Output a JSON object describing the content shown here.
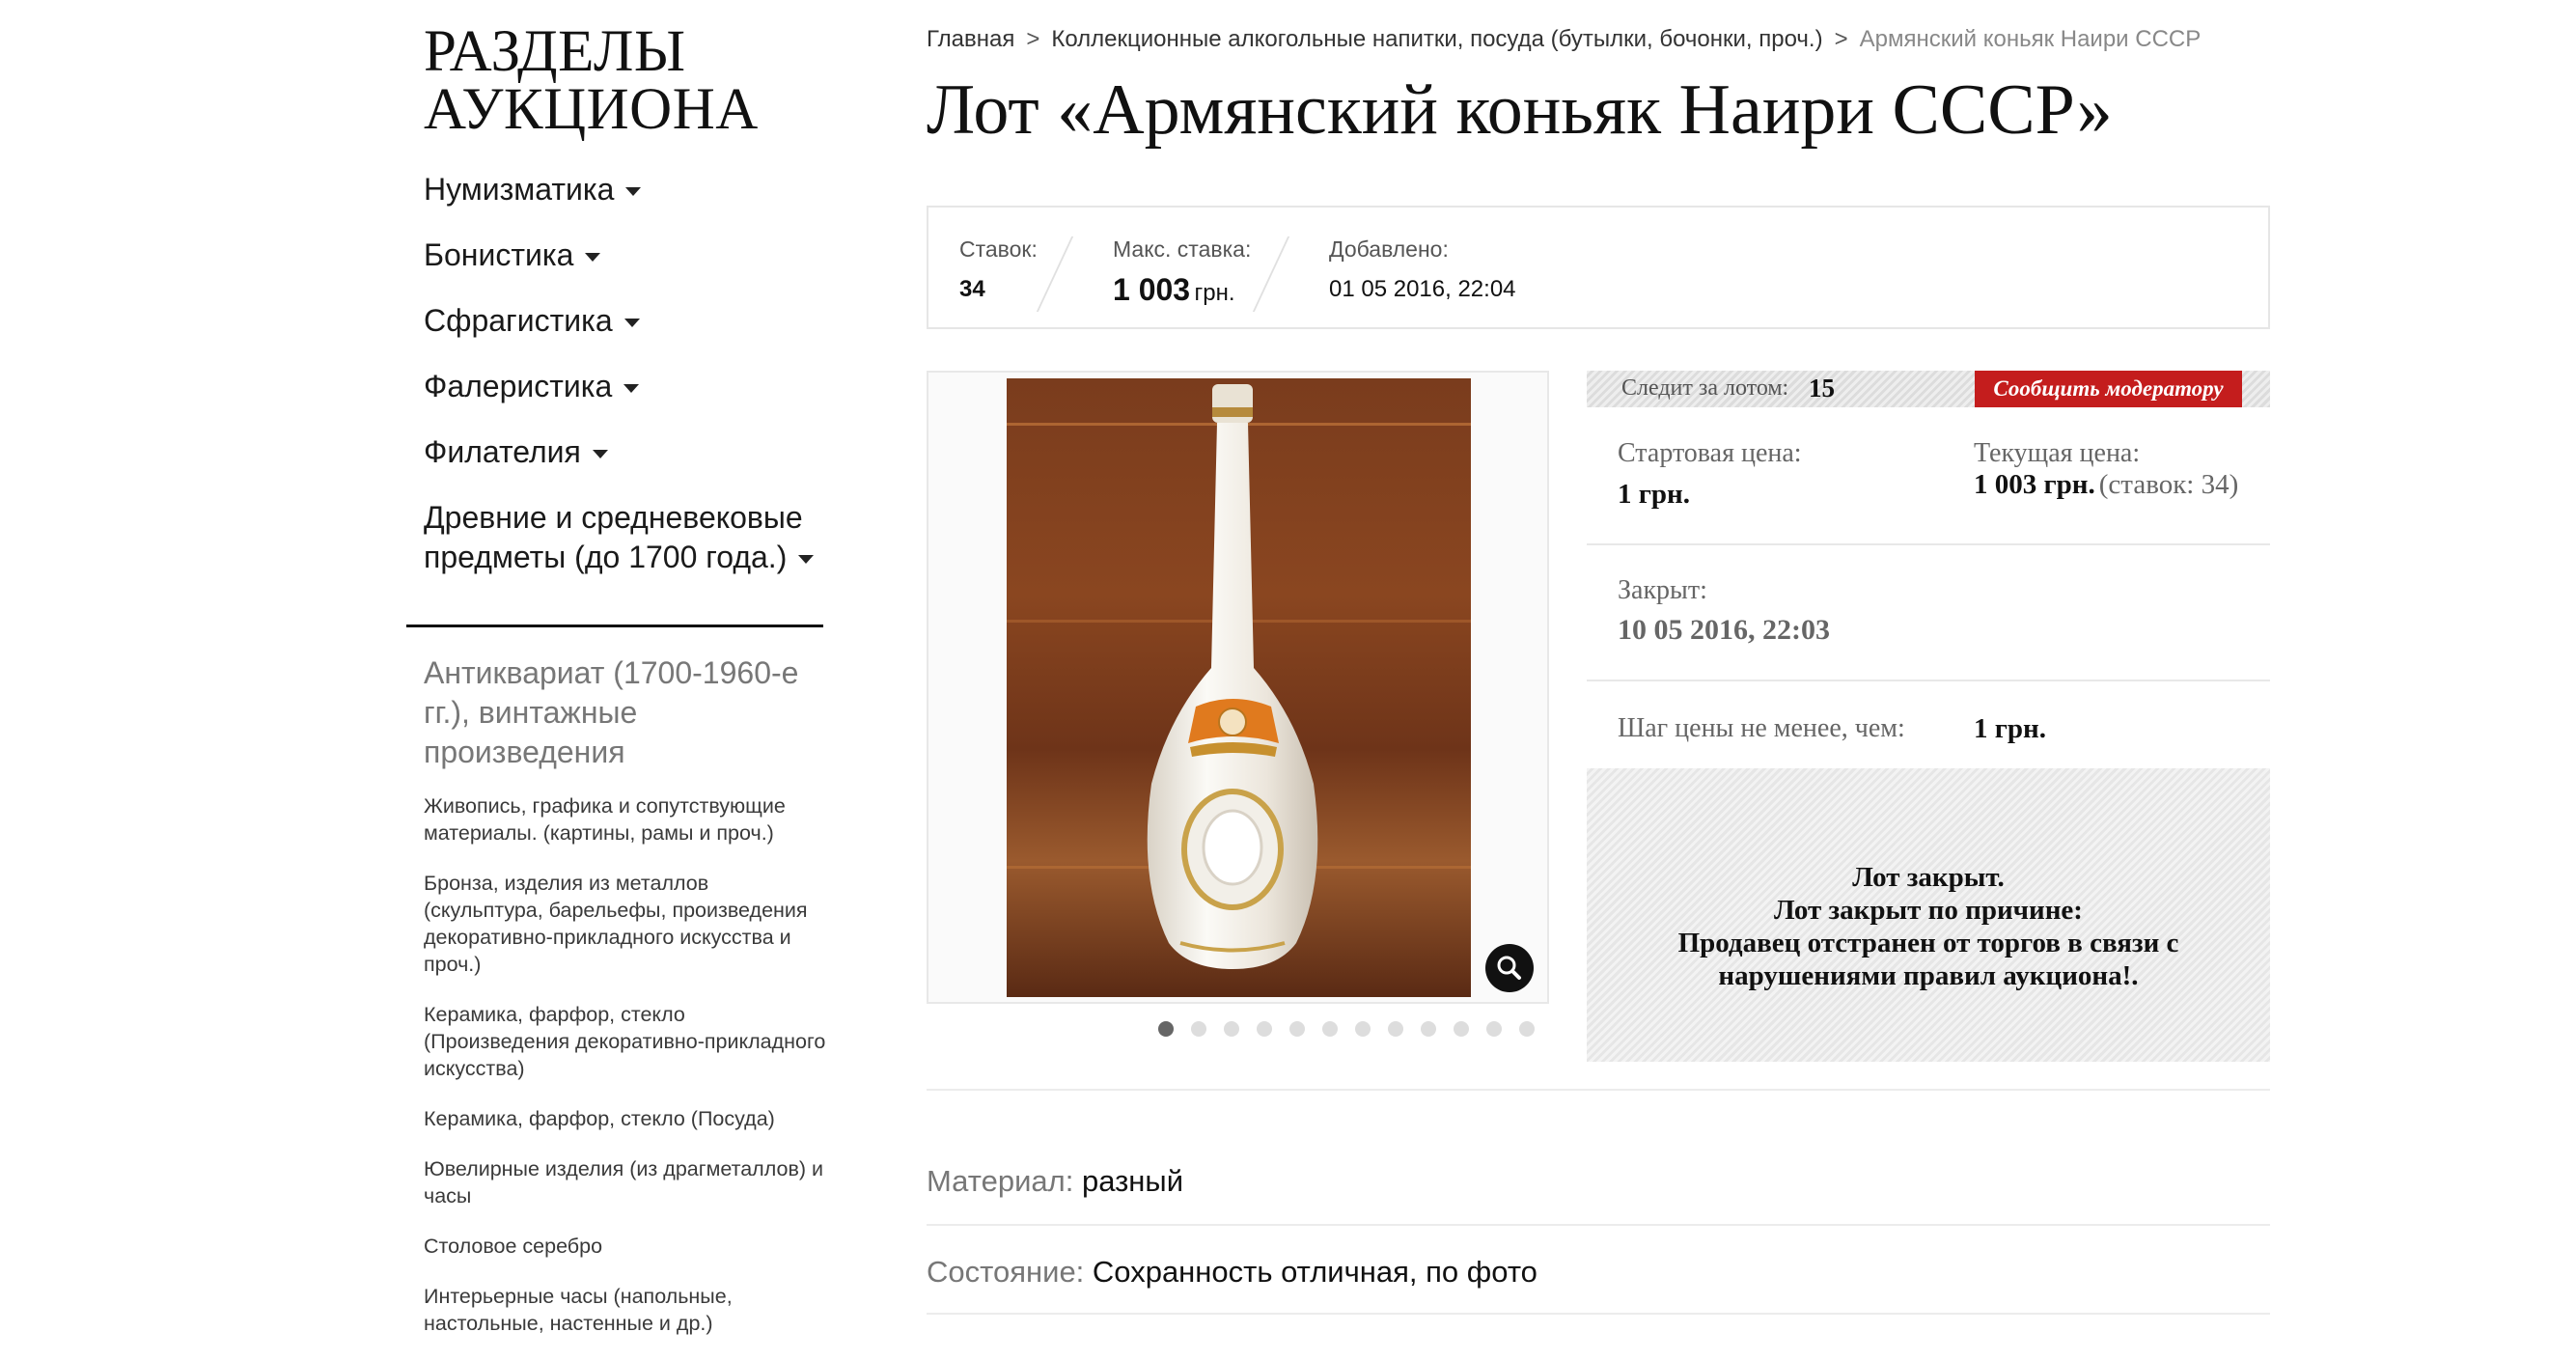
{
  "sidebar": {
    "title": "РАЗДЕЛЫ АУКЦИОНА",
    "main_items": [
      {
        "label": "Нумизматика"
      },
      {
        "label": "Бонистика"
      },
      {
        "label": "Сфрагистика"
      },
      {
        "label": "Фалеристика"
      },
      {
        "label": "Филателия"
      },
      {
        "label": "Древние и средневековые предметы (до 1700 года.)"
      }
    ],
    "group": {
      "title": "Антиквариат (1700-1960-е гг.), винтажные произведения",
      "items": [
        {
          "label": "Живопись, графика и сопутствующие материалы. (картины, рамы и проч.)"
        },
        {
          "label": "Бронза, изделия из металлов (скульптура, барельефы, произведения декоративно-прикладного искусства и проч.)"
        },
        {
          "label": "Керамика, фарфор, стекло (Произведения декоративно-прикладного искусства)"
        },
        {
          "label": "Керамика, фарфор, стекло (Посуда)"
        },
        {
          "label": "Ювелирные изделия (из драгметаллов) и часы"
        },
        {
          "label": "Столовое серебро"
        },
        {
          "label": "Интерьерные часы (напольные, настольные, настенные и др.)"
        }
      ]
    }
  },
  "breadcrumb": {
    "items": [
      "Главная",
      "Коллекционные алкогольные напитки, посуда (бутылки, бочонки, проч.)"
    ],
    "current": "Армянский коньяк Наири СССР",
    "separator": ">"
  },
  "page_title": "Лот «Армянский коньяк Наири СССР»",
  "stats": {
    "bids_label": "Ставок:",
    "bids_value": "34",
    "max_bid_label": "Макс. ставка:",
    "max_bid_value": "1 003",
    "max_bid_currency": "грн.",
    "added_label": "Добавлено:",
    "added_value": "01 05 2016, 22:04"
  },
  "gallery": {
    "photo_icon": "photo-bottle",
    "zoom_icon": "magnifier-icon",
    "dots_total": 12,
    "active_dot": 1
  },
  "info": {
    "watch_label": "Следит за лотом:",
    "watch_count": "15",
    "report_button": "Сообщить модератору",
    "start_price_label": "Стартовая цена:",
    "start_price_value": "1 грн.",
    "current_price_label": "Текущая цена:",
    "current_price_value": "1 003 грн.",
    "current_price_note": "(ставок: 34)",
    "closed_label": "Закрыт:",
    "closed_value": "10 05 2016, 22:03",
    "step_label": "Шаг цены не менее, чем:",
    "step_value": "1 грн.",
    "status_lines": [
      "Лот закрыт.",
      "Лот закрыт по причине:",
      "Продавец отстранен от торгов в связи с нарушениями правил аукциона!."
    ]
  },
  "properties": [
    {
      "key": "Материал:",
      "value": "разный"
    },
    {
      "key": "Состояние:",
      "value": "Сохранность отличная, по фото"
    }
  ],
  "colors": {
    "report_button": "#c41d1d",
    "muted_text": "#777777",
    "border": "#e6e6e6"
  }
}
